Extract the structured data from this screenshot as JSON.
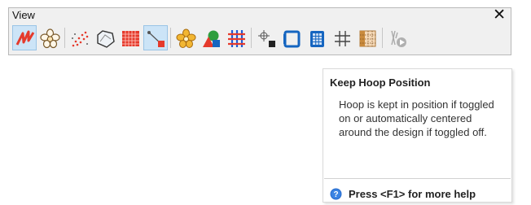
{
  "toolbar": {
    "title": "View",
    "close_glyph": "✕",
    "buttons": [
      {
        "id": "show-stitches",
        "icon": "zigzag-stitch-icon",
        "active": true
      },
      {
        "id": "show-objects",
        "icon": "flower-outline-icon",
        "active": false
      },
      {
        "id": "show-needle-points",
        "icon": "needle-points-icon",
        "active": false
      },
      {
        "id": "show-outlines",
        "icon": "polygon-outline-icon",
        "active": false
      },
      {
        "id": "show-fills",
        "icon": "red-fill-grid-icon",
        "active": false
      },
      {
        "id": "show-connectors",
        "icon": "connector-icon",
        "active": true
      },
      {
        "id": "show-design",
        "icon": "yellow-flower-icon",
        "active": false
      },
      {
        "id": "show-shapes",
        "icon": "shapes-icon",
        "active": false
      },
      {
        "id": "show-grid-color",
        "icon": "color-grid-icon",
        "active": false
      },
      {
        "id": "reference-point",
        "icon": "crosshair-point-icon",
        "active": false
      },
      {
        "id": "show-hoop",
        "icon": "hoop-icon",
        "active": false
      },
      {
        "id": "keep-hoop-position",
        "icon": "hoop-grid-icon",
        "active": false
      },
      {
        "id": "show-grid",
        "icon": "grid-icon",
        "active": false
      },
      {
        "id": "show-background",
        "icon": "background-pattern-icon",
        "active": false
      },
      {
        "id": "stitch-player",
        "icon": "stitch-player-icon",
        "active": false
      }
    ]
  },
  "tooltip": {
    "title": "Keep Hoop Position",
    "body": "Hoop is kept in position if toggled on or automatically centered around the design if toggled off.",
    "help": "Press <F1> for more help"
  },
  "colors": {
    "active_bg": "#cce4f7",
    "red": "#e53a2c",
    "blue": "#1565c0",
    "yellow": "#f2b632"
  }
}
